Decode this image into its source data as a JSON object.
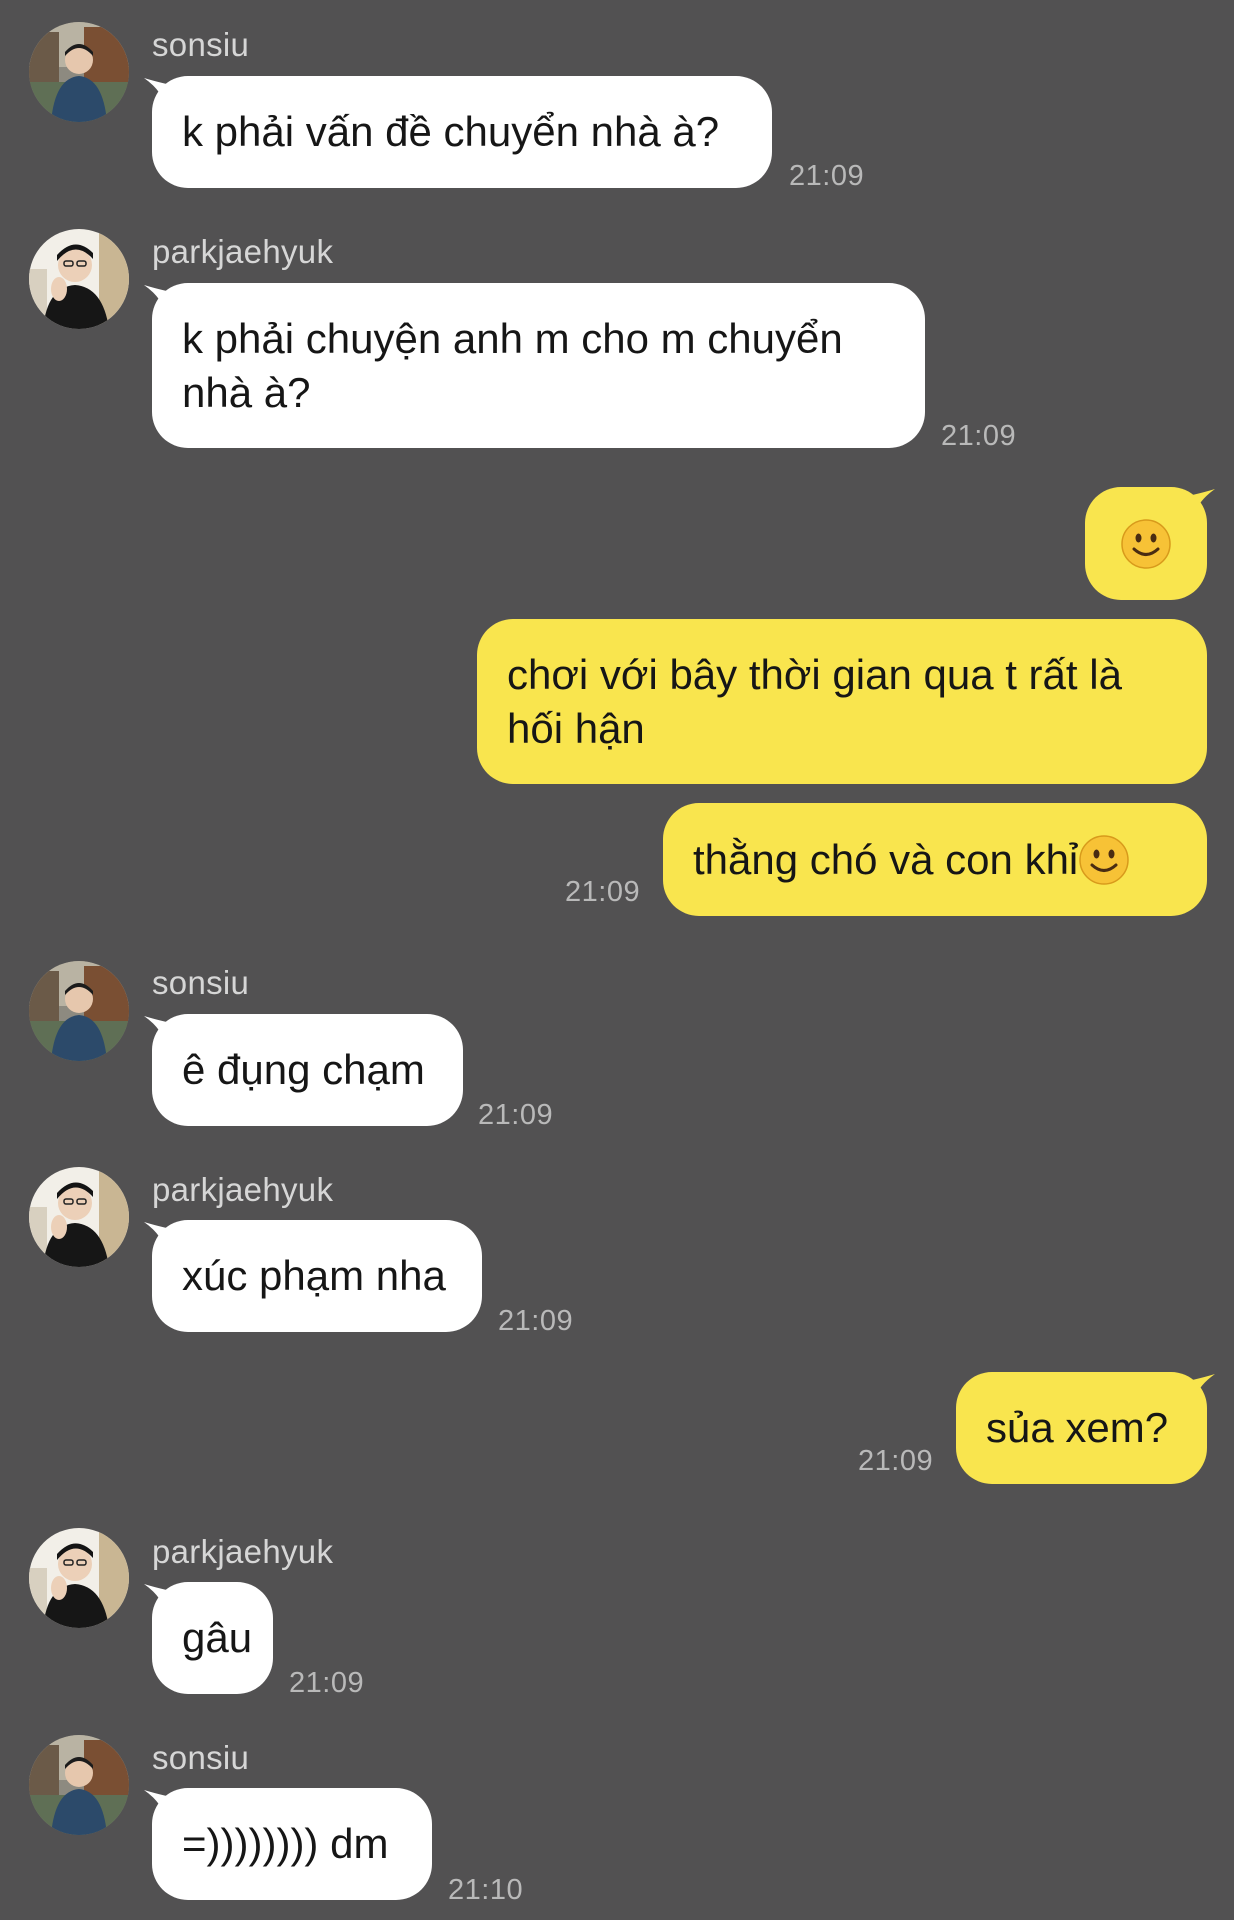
{
  "messages": [
    {
      "sender": "sonsiu",
      "text": "k phải vấn đề chuyển nhà à?",
      "time": "21:09"
    },
    {
      "sender": "parkjaehyuk",
      "text": "k phải chuyện anh m cho m chuyển\nnhà à?",
      "time": "21:09"
    },
    {
      "sender": "me",
      "emoji": "slightly-smiling-face-icon"
    },
    {
      "sender": "me",
      "text": "chơi với bây thời gian qua t rất là\nhối hận"
    },
    {
      "sender": "me",
      "text": "thằng chó và con khỉ",
      "emoji": "slightly-smiling-face-icon",
      "time": "21:09"
    },
    {
      "sender": "sonsiu",
      "text": "ê đụng chạm",
      "time": "21:09"
    },
    {
      "sender": "parkjaehyuk",
      "text": "xúc phạm nha",
      "time": "21:09"
    },
    {
      "sender": "me",
      "text": "sủa xem?",
      "time": "21:09"
    },
    {
      "sender": "parkjaehyuk",
      "text": "gâu",
      "time": "21:09"
    },
    {
      "sender": "sonsiu",
      "text": "=)))))))) dm",
      "time": "21:10"
    }
  ],
  "colors": {
    "background": "#525152",
    "incoming_bubble": "#ffffff",
    "outgoing_bubble": "#f9e54e",
    "timestamp": "#b9b9b9",
    "sender_name": "#d6d6d6"
  }
}
